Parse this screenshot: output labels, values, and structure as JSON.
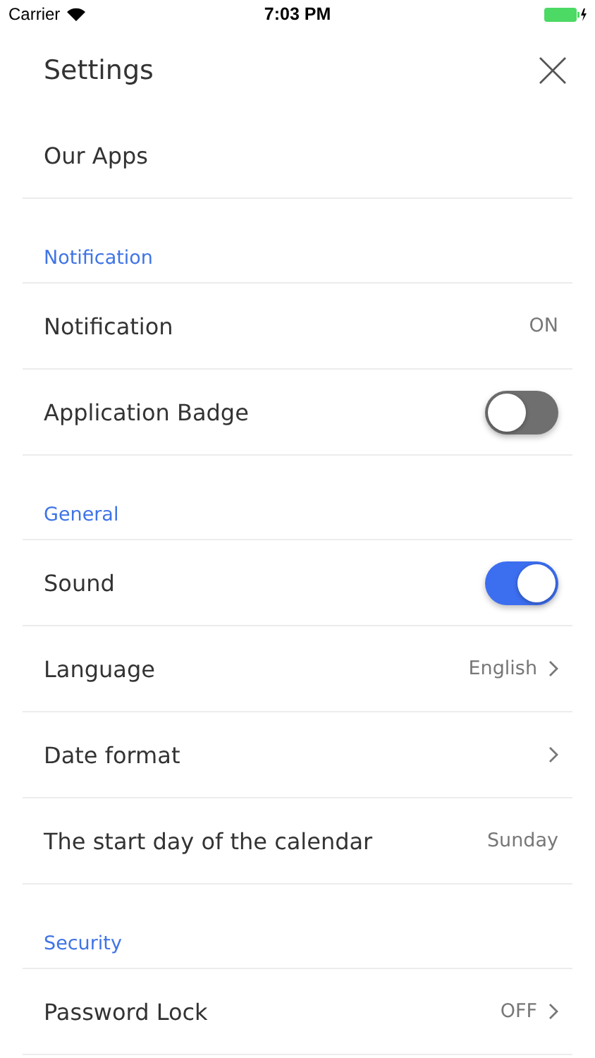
{
  "status_bar": {
    "carrier": "Carrier",
    "time": "7:03 PM"
  },
  "header": {
    "title": "Settings"
  },
  "sections": [
    {
      "items": [
        {
          "kind": "link",
          "label": "Our Apps",
          "chevron": false
        }
      ]
    },
    {
      "title": "Notification",
      "items": [
        {
          "kind": "link",
          "label": "Notification",
          "value": "ON",
          "chevron": false
        },
        {
          "kind": "toggle",
          "label": "Application Badge",
          "on": false
        }
      ]
    },
    {
      "title": "General",
      "items": [
        {
          "kind": "toggle",
          "label": "Sound",
          "on": true
        },
        {
          "kind": "link",
          "label": "Language",
          "value": "English",
          "chevron": true
        },
        {
          "kind": "link",
          "label": "Date format",
          "chevron": true
        },
        {
          "kind": "link",
          "label": "The start day of the calendar",
          "value": "Sunday",
          "chevron": false
        }
      ]
    },
    {
      "title": "Security",
      "items": [
        {
          "kind": "link",
          "label": "Password Lock",
          "value": "OFF",
          "chevron": true
        }
      ]
    }
  ]
}
